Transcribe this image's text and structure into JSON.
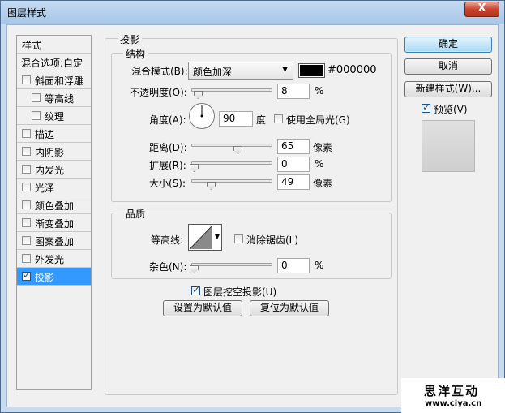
{
  "window": {
    "title": "图层样式",
    "close_label": "X"
  },
  "style_list": {
    "header": "样式",
    "blend_options": "混合选项:自定",
    "items": [
      {
        "label": "斜面和浮雕",
        "checked": false
      },
      {
        "label": "等高线",
        "checked": false
      },
      {
        "label": "纹理",
        "checked": false
      },
      {
        "label": "描边",
        "checked": false
      },
      {
        "label": "内阴影",
        "checked": false
      },
      {
        "label": "内发光",
        "checked": false
      },
      {
        "label": "光泽",
        "checked": false
      },
      {
        "label": "颜色叠加",
        "checked": false
      },
      {
        "label": "渐变叠加",
        "checked": false
      },
      {
        "label": "图案叠加",
        "checked": false
      },
      {
        "label": "外发光",
        "checked": false
      },
      {
        "label": "投影",
        "checked": true
      }
    ]
  },
  "panel": {
    "title": "投影",
    "structure": {
      "title": "结构",
      "blend_mode_label": "混合模式(B):",
      "blend_mode_value": "颜色加深",
      "color_hex": "#000000",
      "color": "#000000",
      "opacity_label": "不透明度(O):",
      "opacity_value": "8",
      "opacity_fraction": 0.08,
      "percent": "%",
      "angle_label": "角度(A):",
      "angle_value": "90",
      "angle_unit": "度",
      "global_light_label": "使用全局光(G)",
      "global_light_checked": false,
      "distance_label": "距离(D):",
      "distance_value": "65",
      "pixel_unit": "像素",
      "spread_label": "扩展(R):",
      "spread_value": "0",
      "size_label": "大小(S):",
      "size_value": "49"
    },
    "quality": {
      "title": "品质",
      "contour_label": "等高线:",
      "anti_alias_label": "消除锯齿(L)",
      "anti_alias_checked": false,
      "noise_label": "杂色(N):",
      "noise_value": "0",
      "percent": "%"
    },
    "knockout_label": "图层挖空投影(U)",
    "knockout_checked": true,
    "set_default_label": "设置为默认值",
    "reset_default_label": "复位为默认值"
  },
  "side_buttons": {
    "ok_label": "确定",
    "cancel_label": "取消",
    "new_style_label": "新建样式(W)...",
    "preview_label": "预览(V)",
    "preview_checked": true
  },
  "watermark": {
    "line1": "思洋互动",
    "line2": "www.ciya.cn"
  }
}
